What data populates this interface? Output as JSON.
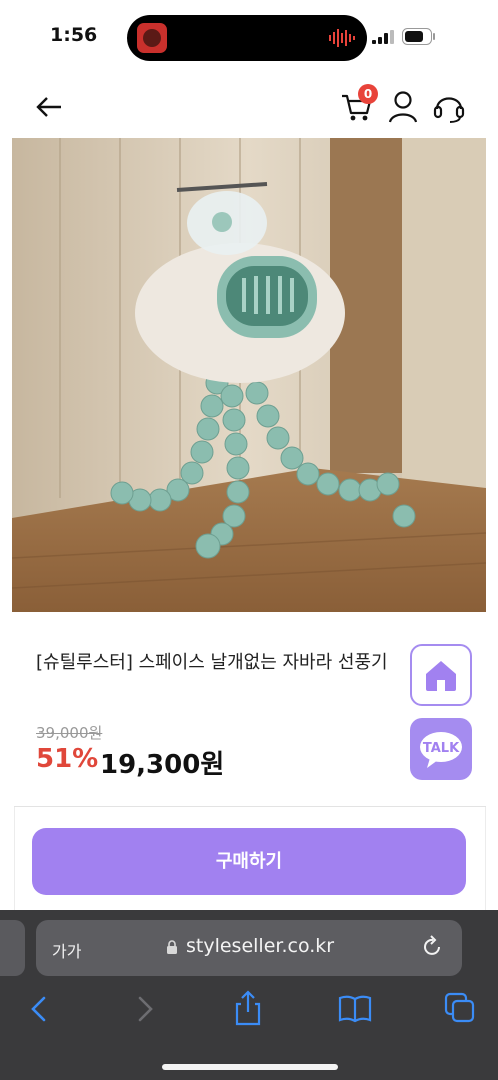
{
  "status_bar": {
    "time": "1:56"
  },
  "header": {
    "cart_count": "0"
  },
  "product": {
    "title": "[슈틸루스터] 스페이스 날개없는 자바라 선풍기",
    "original_price": "39,000원",
    "discount_rate": "51%",
    "sale_price": "19,300원"
  },
  "side_buttons": {
    "talk_label": "TALK"
  },
  "actions": {
    "buy_label": "구매하기"
  },
  "browser": {
    "text_size_label": "가가",
    "url": "styleseller.co.kr"
  },
  "colors": {
    "accent": "#a181f0",
    "discount": "#e0473a",
    "badge": "#e8433a"
  }
}
